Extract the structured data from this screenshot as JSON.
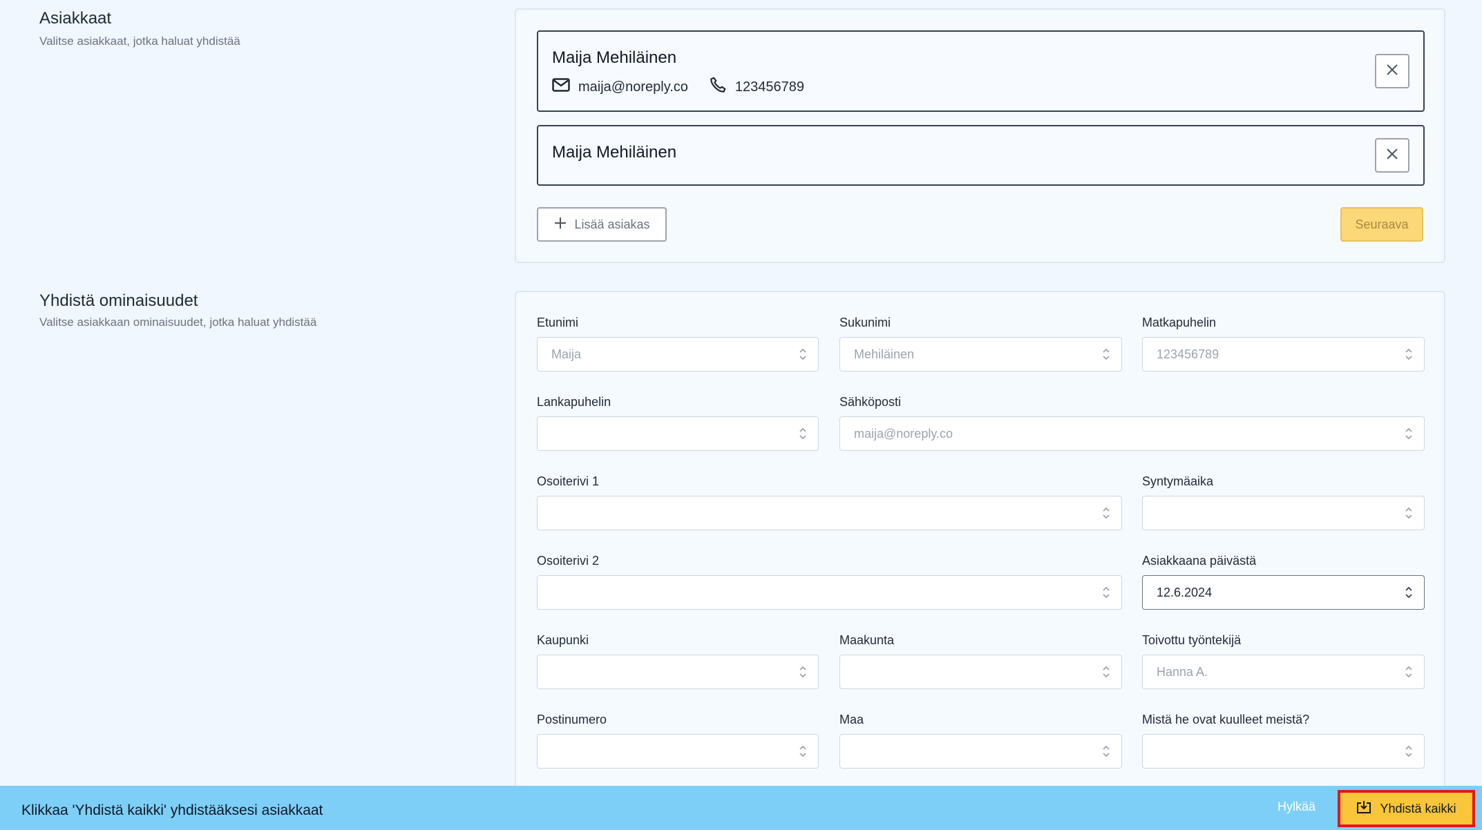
{
  "customers_section": {
    "title": "Asiakkaat",
    "description": "Valitse asiakkaat, jotka haluat yhdistää",
    "customers": [
      {
        "name": "Maija Mehiläinen",
        "email": "maija@noreply.co",
        "phone": "123456789"
      },
      {
        "name": "Maija Mehiläinen"
      }
    ],
    "add_customer_label": "Lisää asiakas",
    "next_label": "Seuraava"
  },
  "properties_section": {
    "title": "Yhdistä ominaisuudet",
    "description": "Valitse asiakkaan ominaisuudet, jotka haluat yhdistää",
    "fields": {
      "first_name": {
        "label": "Etunimi",
        "value": "Maija"
      },
      "last_name": {
        "label": "Sukunimi",
        "value": "Mehiläinen"
      },
      "mobile": {
        "label": "Matkapuhelin",
        "value": "123456789"
      },
      "landline": {
        "label": "Lankapuhelin",
        "value": ""
      },
      "email": {
        "label": "Sähköposti",
        "value": "maija@noreply.co"
      },
      "address1": {
        "label": "Osoiterivi 1",
        "value": ""
      },
      "birthdate": {
        "label": "Syntymäaika",
        "value": ""
      },
      "address2": {
        "label": "Osoiterivi 2",
        "value": ""
      },
      "customer_since": {
        "label": "Asiakkaana päivästä",
        "value": "12.6.2024"
      },
      "city": {
        "label": "Kaupunki",
        "value": ""
      },
      "region": {
        "label": "Maakunta",
        "value": ""
      },
      "preferred_employee": {
        "label": "Toivottu työntekijä",
        "value": "Hanna A."
      },
      "postal_code": {
        "label": "Postinumero",
        "value": ""
      },
      "country": {
        "label": "Maa",
        "value": ""
      },
      "referral": {
        "label": "Mistä he ovat kuulleet meistä?",
        "value": ""
      }
    }
  },
  "bottom_bar": {
    "message": "Klikkaa 'Yhdistä kaikki' yhdistääksesi asiakkaat",
    "reject_label": "Hylkää",
    "merge_all_label": "Yhdistä kaikki"
  },
  "colors": {
    "background": "#f0f7fe",
    "bottom_bar": "#7dcff7",
    "merge_button": "#f9c63a",
    "highlight_border": "#e8141b"
  }
}
